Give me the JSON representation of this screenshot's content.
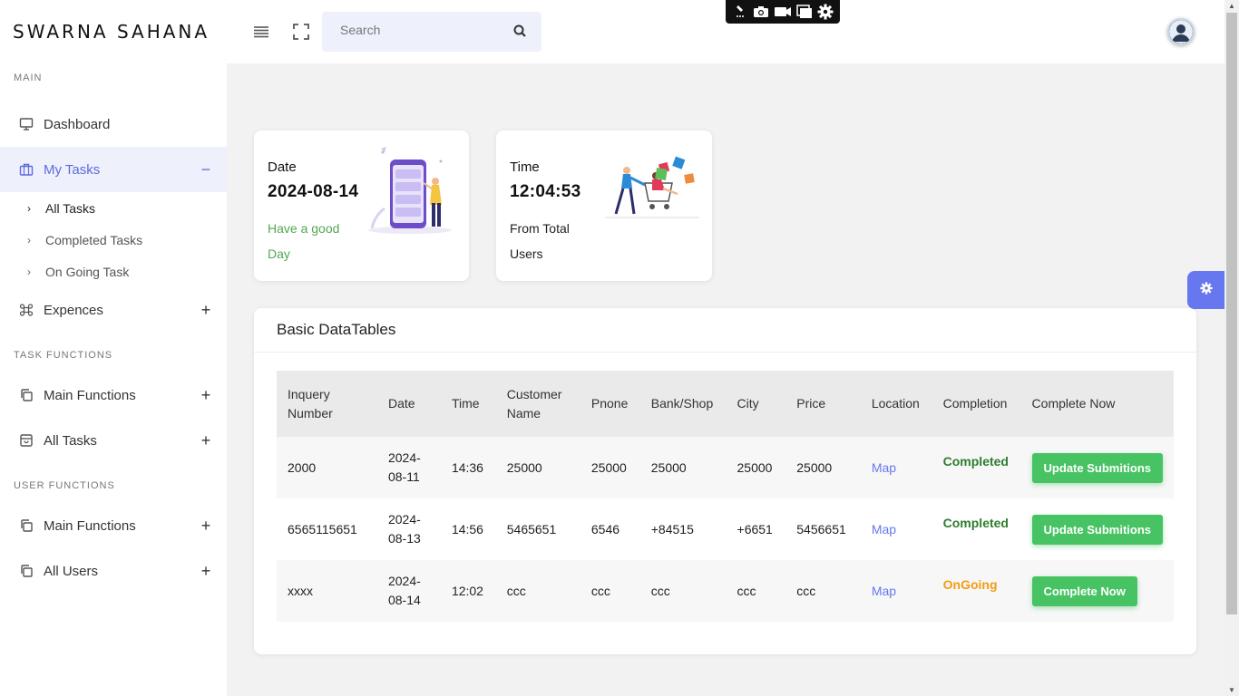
{
  "brand": "SWARNA SAHANA",
  "sidebar": {
    "sections": {
      "main": "MAIN",
      "task_functions": "TASK FUNCTIONS",
      "user_functions": "USER FUNCTIONS"
    },
    "dashboard": "Dashboard",
    "my_tasks": "My Tasks",
    "my_tasks_toggle": "−",
    "sub_items": [
      "All Tasks",
      "Completed Tasks",
      "On Going Task"
    ],
    "expences": "Expences",
    "task_main_functions": "Main Functions",
    "task_all_tasks": "All Tasks",
    "user_main_functions": "Main Functions",
    "user_all_users": "All Users",
    "plus": "+"
  },
  "header": {
    "search_placeholder": "Search"
  },
  "cards": {
    "date": {
      "label": "Date",
      "value": "2024-08-14",
      "note": "Have a good Day"
    },
    "time": {
      "label": "Time",
      "value": "12:04:53",
      "note": "From Total Users"
    }
  },
  "table": {
    "title": "Basic DataTables",
    "columns": [
      "Inquery Number",
      "Date",
      "Time",
      "Customer Name",
      "Pnone",
      "Bank/Shop",
      "City",
      "Price",
      "Location",
      "Completion",
      "Complete Now"
    ],
    "rows": [
      {
        "inquery": "2000",
        "date": "2024-08-11",
        "time": "14:36",
        "customer": "25000",
        "phone": "25000",
        "bank": "25000",
        "city": "25000",
        "price": "25000",
        "location": "Map",
        "completion": "Completed",
        "action": "Update Submitions"
      },
      {
        "inquery": "6565115651",
        "date": "2024-08-13",
        "time": "14:56",
        "customer": "5465651",
        "phone": "6546",
        "bank": "+84515",
        "city": "+6651",
        "price": "5456651",
        "location": "Map",
        "completion": "Completed",
        "action": "Update Submitions"
      },
      {
        "inquery": "xxxx",
        "date": "2024-08-14",
        "time": "12:02",
        "customer": "ccc",
        "phone": "ccc",
        "bank": "ccc",
        "city": "ccc",
        "price": "ccc",
        "location": "Map",
        "completion": "OnGoing",
        "action": "Complete Now"
      }
    ]
  },
  "colors": {
    "accent": "#6777ef",
    "success": "#47c363",
    "completed_text": "#2e7d2e",
    "ongoing_text": "#f39c12"
  }
}
